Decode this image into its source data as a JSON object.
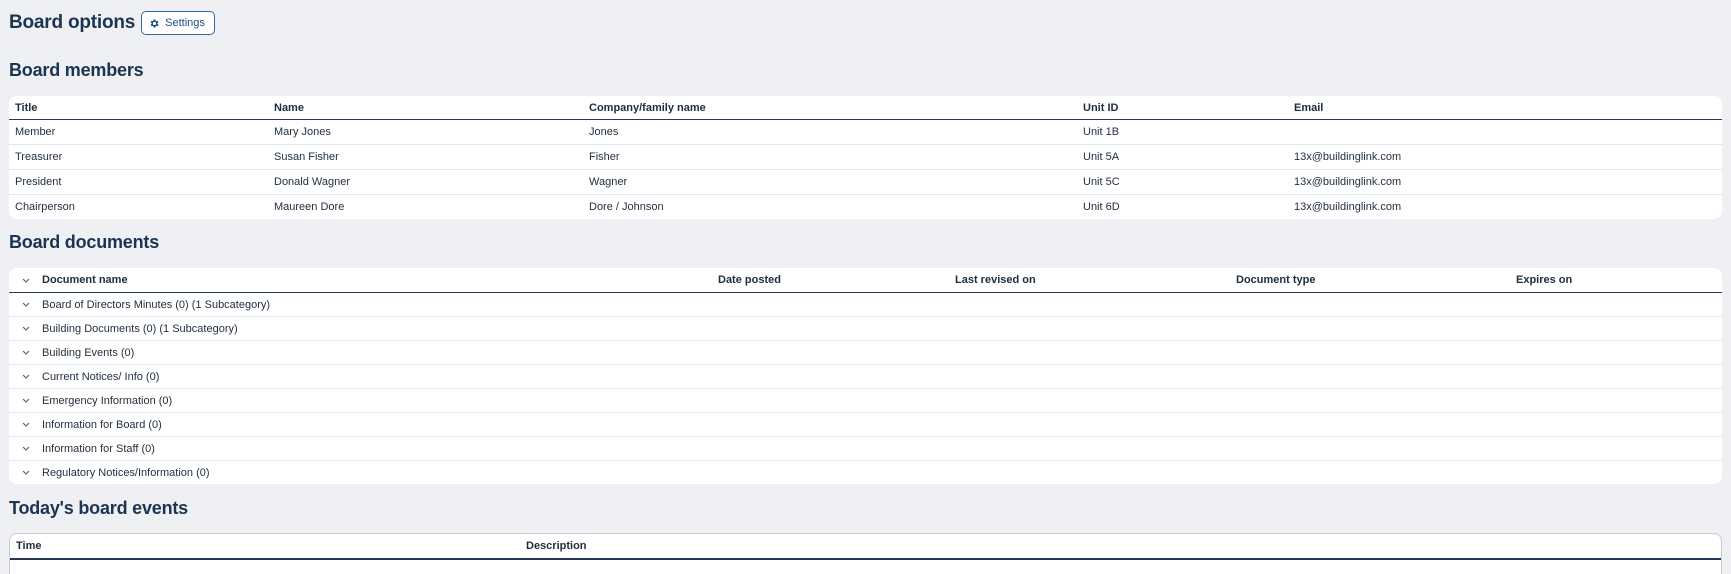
{
  "header": {
    "title": "Board options",
    "settings_label": "Settings",
    "settings_icon": "gear-icon"
  },
  "members": {
    "heading": "Board members",
    "columns": [
      "Title",
      "Name",
      "Company/family name",
      "Unit ID",
      "Email"
    ],
    "rows": [
      [
        "Member",
        "Mary Jones",
        "Jones",
        "Unit 1B",
        ""
      ],
      [
        "Treasurer",
        "Susan Fisher",
        "Fisher",
        "Unit 5A",
        "13x@buildinglink.com"
      ],
      [
        "President",
        "Donald Wagner",
        "Wagner",
        "Unit 5C",
        "13x@buildinglink.com"
      ],
      [
        "Chairperson",
        "Maureen Dore",
        "Dore / Johnson",
        "Unit 6D",
        "13x@buildinglink.com"
      ]
    ]
  },
  "documents": {
    "heading": "Board documents",
    "columns": [
      "Document name",
      "Date posted",
      "Last revised on",
      "Document type",
      "Expires on"
    ],
    "categories": [
      "Board of Directors Minutes (0) (1 Subcategory)",
      "Building Documents (0) (1 Subcategory)",
      "Building Events (0)",
      "Current Notices/ Info (0)",
      "Emergency Information (0)",
      "Information for Board (0)",
      "Information for Staff (0)",
      "Regulatory Notices/Information (0)"
    ]
  },
  "events": {
    "heading": "Today's board events",
    "columns": [
      "Time",
      "Description"
    ]
  },
  "colors": {
    "background": "#eff0f3",
    "heading": "#1b3452",
    "accent": "#2a6aa8"
  }
}
